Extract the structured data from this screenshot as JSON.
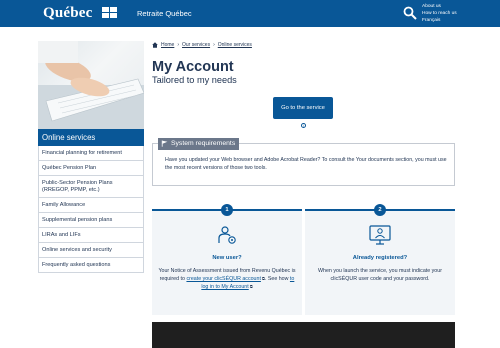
{
  "header": {
    "logo": "Québec",
    "org": "Retraite Québec",
    "links": [
      "About us",
      "How to reach us",
      "Français"
    ]
  },
  "sidebar": {
    "title": "Online services",
    "items": [
      "Financial planning for retirement",
      "Québec Pension Plan",
      "Public-Sector Pension Plans (RREGOP, PPMP, etc.)",
      "Family Allowance",
      "Supplemental pension plans",
      "LIRAs and LIFs",
      "Online services and security",
      "Frequently asked questions"
    ]
  },
  "breadcrumb": [
    "Home",
    "Our services",
    "Online services"
  ],
  "page": {
    "title": "My Account",
    "subtitle": "Tailored to my needs",
    "go_button": "Go to the service",
    "info_glyph": "i"
  },
  "system": {
    "label": "System requirements",
    "text": "Have you updated your Web browser and Adobe Acrobat Reader? To consult the Your documents section, you must use the most recent versions of those two tools."
  },
  "cards": [
    {
      "number": "1",
      "heading": "New user?",
      "text_1": "Your Notice of Assessment issued from Revenu Québec is required to ",
      "link_1": "create your clicSÉQUR account",
      "text_2": ". See how ",
      "link_2": "to log in to My Account",
      "text_3": "."
    },
    {
      "number": "2",
      "heading": "Already registered?",
      "text_1": "When you launch the service, you must indicate your clicSÉQUR user code and your password."
    }
  ],
  "colors": {
    "brand": "#095797",
    "text": "#223654",
    "label_bg": "#6b778a",
    "card_bg": "#f2f5f8"
  }
}
